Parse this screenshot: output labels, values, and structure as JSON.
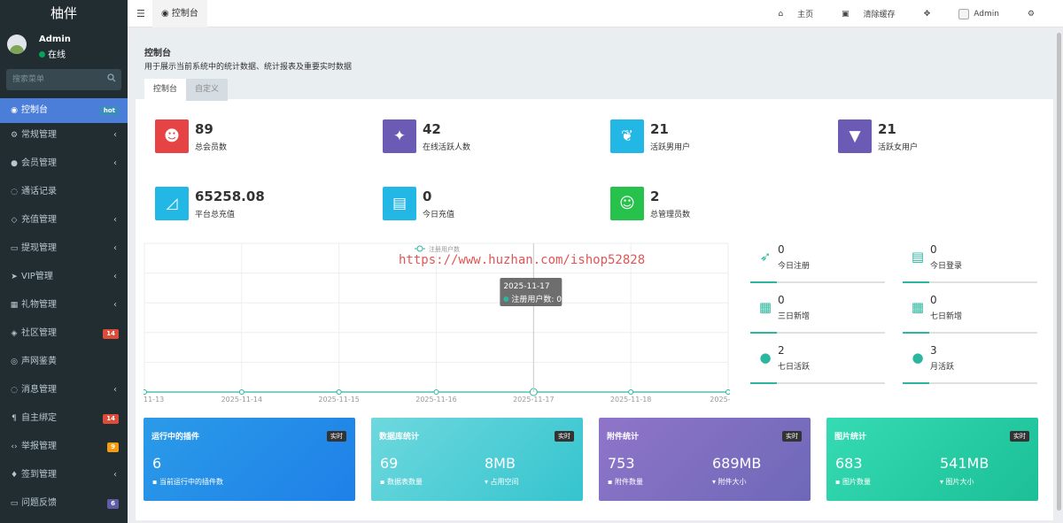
{
  "sidebar": {
    "logo": "柚伴",
    "user": {
      "name": "Admin",
      "status": "在线"
    },
    "search_placeholder": "搜索菜单",
    "items": [
      {
        "label": "控制台",
        "icon": "dashboard-icon",
        "badge": "hot",
        "badge_color": "#3c8dbc",
        "active": true
      },
      {
        "label": "常规管理",
        "icon": "cogs-icon",
        "arrow": true
      },
      {
        "label": "会员管理",
        "icon": "user-circle-icon",
        "arrow": true
      },
      {
        "label": "通话记录",
        "icon": "comments-icon"
      },
      {
        "label": "充值管理",
        "icon": "diamond-icon",
        "arrow": true
      },
      {
        "label": "提现管理",
        "icon": "laptop-icon",
        "arrow": true
      },
      {
        "label": "VIP管理",
        "icon": "send-icon",
        "arrow": true
      },
      {
        "label": "礼物管理",
        "icon": "gift-icon",
        "arrow": true
      },
      {
        "label": "社区管理",
        "icon": "tags-icon",
        "badge": "14",
        "badge_color": "#dd4b39"
      },
      {
        "label": "声网鉴黄",
        "icon": "instagram-icon"
      },
      {
        "label": "消息管理",
        "icon": "comment-icon",
        "arrow": true
      },
      {
        "label": "自主绑定",
        "icon": "paragraph-icon",
        "badge": "14",
        "badge_color": "#dd4b39"
      },
      {
        "label": "举报管理",
        "icon": "code-icon",
        "badge": "9",
        "badge_color": "#f39c12"
      },
      {
        "label": "签到管理",
        "icon": "map-marker-icon",
        "arrow": true
      },
      {
        "label": "问题反馈",
        "icon": "desktop-icon",
        "badge": "6",
        "badge_color": "#605ca8"
      }
    ]
  },
  "topbar": {
    "tab": "控制台",
    "home": "主页",
    "clear_cache": "清除缓存",
    "user": "Admin"
  },
  "page": {
    "title": "控制台",
    "desc": "用于展示当前系统中的统计数据、统计报表及重要实时数据",
    "tabs": [
      "控制台",
      "自定义"
    ]
  },
  "stats": [
    {
      "value": "89",
      "label": "总会员数",
      "color": "#e64444",
      "icon": "users-icon"
    },
    {
      "value": "42",
      "label": "在线活跃人数",
      "color": "#6b5bb4",
      "icon": "magic-icon"
    },
    {
      "value": "21",
      "label": "活跃男用户",
      "color": "#23b7e5",
      "icon": "leaf-icon"
    },
    {
      "value": "21",
      "label": "活跃女用户",
      "color": "#6b5bb4",
      "icon": "bookmark-icon"
    },
    {
      "value": "65258.08",
      "label": "平台总充值",
      "color": "#23b7e5",
      "icon": "area-chart-icon"
    },
    {
      "value": "0",
      "label": "今日充值",
      "color": "#23b7e5",
      "icon": "archive-icon"
    },
    {
      "value": "2",
      "label": "总管理员数",
      "color": "#27c24c",
      "icon": "user-icon"
    }
  ],
  "chart_data": {
    "type": "line",
    "series": [
      {
        "name": "注册用户数",
        "values": [
          0,
          0,
          0,
          0,
          0,
          0,
          0
        ]
      }
    ],
    "categories": [
      "2025-11-13",
      "2025-11-14",
      "2025-11-15",
      "2025-11-16",
      "2025-11-17",
      "2025-11-18",
      "2025-11-19"
    ],
    "tick_labels": [
      "11-13",
      "2025-11-14",
      "2025-11-15",
      "2025-11-16",
      "2025-11-17",
      "2025-11-18",
      "2025-11-1"
    ],
    "tooltip": {
      "title": "2025-11-17",
      "text": "注册用户数: 0"
    },
    "legend": "top",
    "grid": true,
    "color": "#2bb6a0"
  },
  "mini_stats": [
    {
      "value": "0",
      "label": "今日注册",
      "icon": "rocket-icon"
    },
    {
      "value": "0",
      "label": "今日登录",
      "icon": "vcard-icon"
    },
    {
      "value": "0",
      "label": "三日新增",
      "icon": "calendar-icon"
    },
    {
      "value": "0",
      "label": "七日新增",
      "icon": "calendar-plus-icon"
    },
    {
      "value": "2",
      "label": "七日活跃",
      "icon": "user-circle-icon"
    },
    {
      "value": "3",
      "label": "月活跃",
      "icon": "user-circle-icon"
    }
  ],
  "cards": [
    {
      "title": "运行中的插件",
      "badge": "实时",
      "v1": "6",
      "s1": "当前运行中的插件数",
      "v2": "",
      "s2": "",
      "bg": "linear-gradient(135deg,#2b9be8,#1e80e8)"
    },
    {
      "title": "数据库统计",
      "badge": "实时",
      "v1": "69",
      "s1": "数据表数量",
      "v2": "8MB",
      "s2": "占用空间",
      "bg": "linear-gradient(135deg,#6ed8de,#35c4ce)"
    },
    {
      "title": "附件统计",
      "badge": "实时",
      "v1": "753",
      "s1": "附件数量",
      "v2": "689MB",
      "s2": "附件大小",
      "bg": "linear-gradient(135deg,#8f75c9,#6e68b8)"
    },
    {
      "title": "图片统计",
      "badge": "实时",
      "v1": "683",
      "s1": "图片数量",
      "v2": "541MB",
      "s2": "图片大小",
      "bg": "linear-gradient(135deg,#35dbb4,#1cbf96)"
    }
  ],
  "watermark": "https://www.huzhan.com/ishop52828"
}
